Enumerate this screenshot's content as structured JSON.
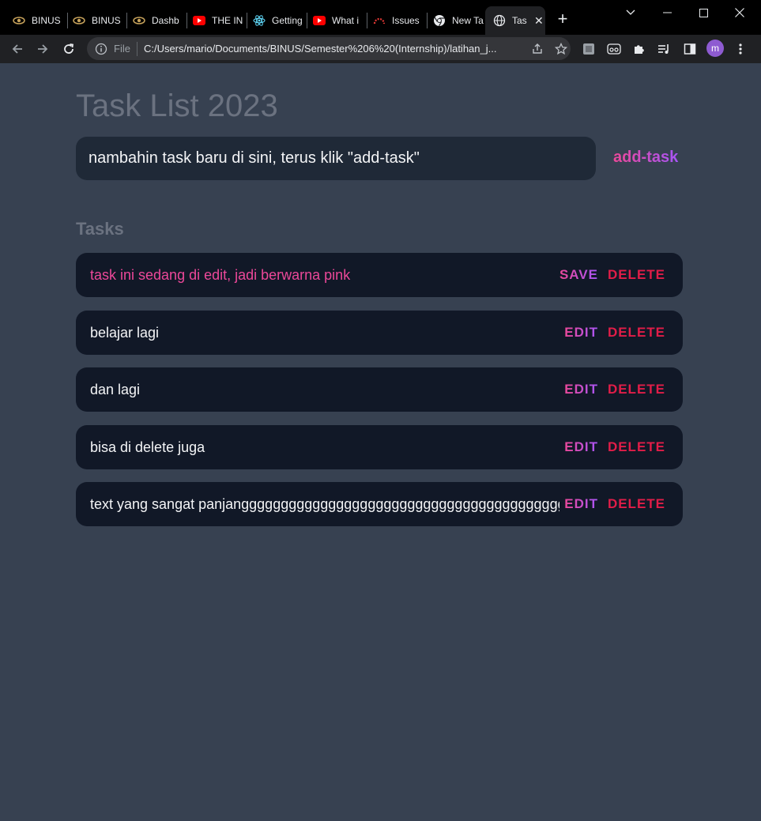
{
  "browser": {
    "tabs": [
      {
        "title": "BINUS",
        "icon": "binus-eye-icon"
      },
      {
        "title": "BINUS",
        "icon": "binus-eye-icon"
      },
      {
        "title": "Dashb",
        "icon": "binus-eye-icon"
      },
      {
        "title": "THE IN",
        "icon": "youtube-icon"
      },
      {
        "title": "Getting",
        "icon": "react-icon"
      },
      {
        "title": "What i",
        "icon": "youtube-icon"
      },
      {
        "title": "Issues",
        "icon": "issues-icon"
      },
      {
        "title": "New Ta",
        "icon": "chrome-icon"
      },
      {
        "title": "Tas",
        "icon": "globe-icon",
        "active": true
      }
    ],
    "omnibox": {
      "security_label": "File",
      "url": "C:/Users/mario/Documents/BINUS/Semester%206%20(Internship)/latihan_j..."
    },
    "profile_initial": "m",
    "colors": {
      "youtube": "#ff0000",
      "react": "#61dafb",
      "profile": "#8e5bd1"
    }
  },
  "app": {
    "title": "Task List 2023",
    "input_value": "nambahin task baru di sini, terus klik \"add-task\"",
    "add_button": "add-task",
    "section_title": "Tasks",
    "tasks": [
      {
        "text": "task ini sedang di edit, jadi berwarna pink",
        "action": "SAVE",
        "delete": "DELETE",
        "editing": true
      },
      {
        "text": "belajar lagi",
        "action": "EDIT",
        "delete": "DELETE"
      },
      {
        "text": "dan lagi",
        "action": "EDIT",
        "delete": "DELETE"
      },
      {
        "text": "bisa di delete juga",
        "action": "EDIT",
        "delete": "DELETE"
      },
      {
        "text": "text yang sangat panjangggggggggggggggggggggggggggggggggggggggggggggg",
        "action": "EDIT",
        "delete": "DELETE"
      }
    ],
    "colors": {
      "background": "#374151",
      "card": "#111827",
      "input": "#1f2937",
      "accent_pink": "#ec4899",
      "accent_purple": "#a855f7",
      "delete_red": "#e11d48"
    }
  }
}
